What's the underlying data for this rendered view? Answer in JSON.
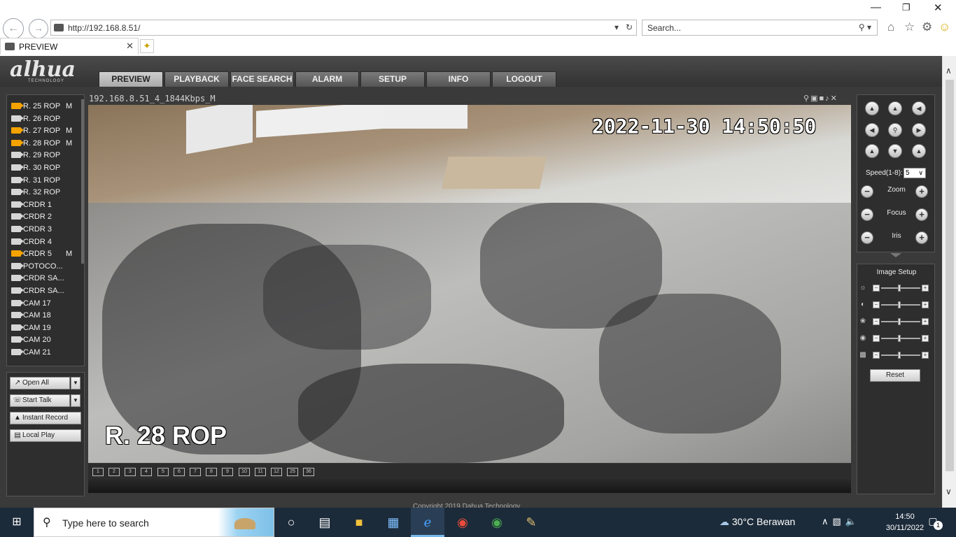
{
  "browser": {
    "url": "http://192.168.8.51/",
    "search_placeholder": "Search...",
    "tab_title": "PREVIEW",
    "window_controls": {
      "minimize_icon": "minimize-icon",
      "restore_icon": "restore-icon",
      "close_icon": "close-icon"
    }
  },
  "app": {
    "logo": "alhua",
    "logo_sub": "TECHNOLOGY",
    "nav": [
      {
        "label": "PREVIEW",
        "active": true
      },
      {
        "label": "PLAYBACK"
      },
      {
        "label": "FACE SEARCH"
      },
      {
        "label": "ALARM"
      },
      {
        "label": "SETUP"
      },
      {
        "label": "INFO"
      },
      {
        "label": "LOGOUT"
      }
    ],
    "channels": [
      {
        "label": "R. 25 ROP",
        "m": "M",
        "active": true
      },
      {
        "label": "R. 26 ROP",
        "m": ""
      },
      {
        "label": "R. 27 ROP",
        "m": "M",
        "active": true
      },
      {
        "label": "R. 28 ROP",
        "m": "M",
        "active": true
      },
      {
        "label": "R. 29 ROP",
        "m": ""
      },
      {
        "label": "R. 30 ROP",
        "m": ""
      },
      {
        "label": "R. 31 ROP",
        "m": ""
      },
      {
        "label": "R. 32 ROP",
        "m": ""
      },
      {
        "label": "CRDR 1",
        "m": ""
      },
      {
        "label": "CRDR 2",
        "m": ""
      },
      {
        "label": "CRDR 3",
        "m": ""
      },
      {
        "label": "CRDR 4",
        "m": ""
      },
      {
        "label": "CRDR 5",
        "m": "M",
        "active": true
      },
      {
        "label": "POTOCO...",
        "m": ""
      },
      {
        "label": "CRDR SA...",
        "m": ""
      },
      {
        "label": "CRDR SA...",
        "m": ""
      },
      {
        "label": "CAM 17",
        "m": ""
      },
      {
        "label": "CAM 18",
        "m": ""
      },
      {
        "label": "CAM 19",
        "m": ""
      },
      {
        "label": "CAM 20",
        "m": ""
      },
      {
        "label": "CAM 21",
        "m": ""
      }
    ],
    "buttons": {
      "open_all": "Open All",
      "start_talk": "Start Talk",
      "instant_record": "Instant Record",
      "local_play": "Local Play"
    },
    "video": {
      "title": "192.168.8.51_4_1844Kbps_M",
      "osd_datetime": "2022-11-30 14:50:50",
      "osd_name": "R. 28 ROP"
    },
    "layouts": [
      "1",
      "2",
      "3",
      "4",
      "5",
      "6",
      "7",
      "8",
      "9",
      "10",
      "11",
      "12",
      "25",
      "36"
    ],
    "ptz": {
      "speed_label": "Speed(1-8):",
      "speed_value": "5",
      "zoom": "Zoom",
      "focus": "Focus",
      "iris": "Iris"
    },
    "image_setup": {
      "title": "Image Setup",
      "rows": [
        "brightness-icon",
        "contrast-icon",
        "saturation-icon",
        "hue-icon",
        "sharpness-icon"
      ],
      "reset": "Reset"
    },
    "copyright": "Copyright 2019 Dahua Technology"
  },
  "taskbar": {
    "search_placeholder": "Type here to search",
    "weather": "30°C  Berawan",
    "time": "14:50",
    "date": "30/11/2022",
    "notifications": "1"
  }
}
